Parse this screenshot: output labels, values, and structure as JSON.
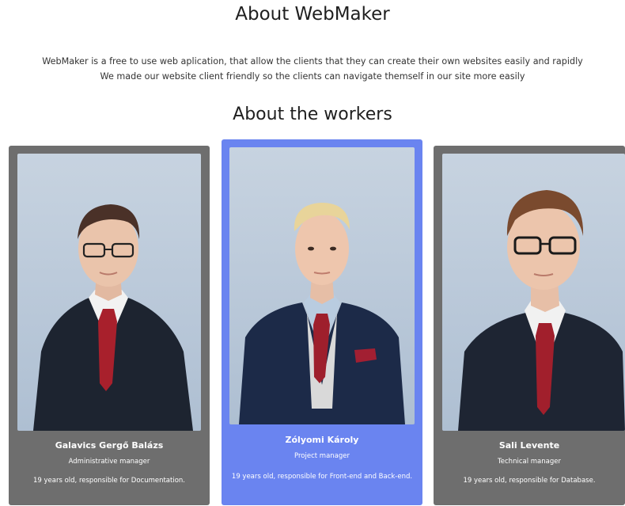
{
  "header": {
    "title": "About WebMaker",
    "intro_line_1": "WebMaker is a free to use web aplication, that allow the clients that they can create their own websites easily and rapidly",
    "intro_line_2": "We made our website client friendly so the clients can navigate themself in our site more easily"
  },
  "workers_section": {
    "title": "About the workers",
    "workers": [
      {
        "name": "Galavics Gergő Balázs",
        "role": "Administrative manager",
        "description": "19 years old, responsible for Documentation.",
        "card_color": "#6e6e6e"
      },
      {
        "name": "Zólyomi Károly",
        "role": "Project manager",
        "description": "19 years old, responsible for Front-end and Back-end.",
        "card_color": "#6a84f0"
      },
      {
        "name": "Sali Levente",
        "role": "Technical manager",
        "description": "19 years old, responsible for Database.",
        "card_color": "#6e6e6e"
      }
    ]
  }
}
